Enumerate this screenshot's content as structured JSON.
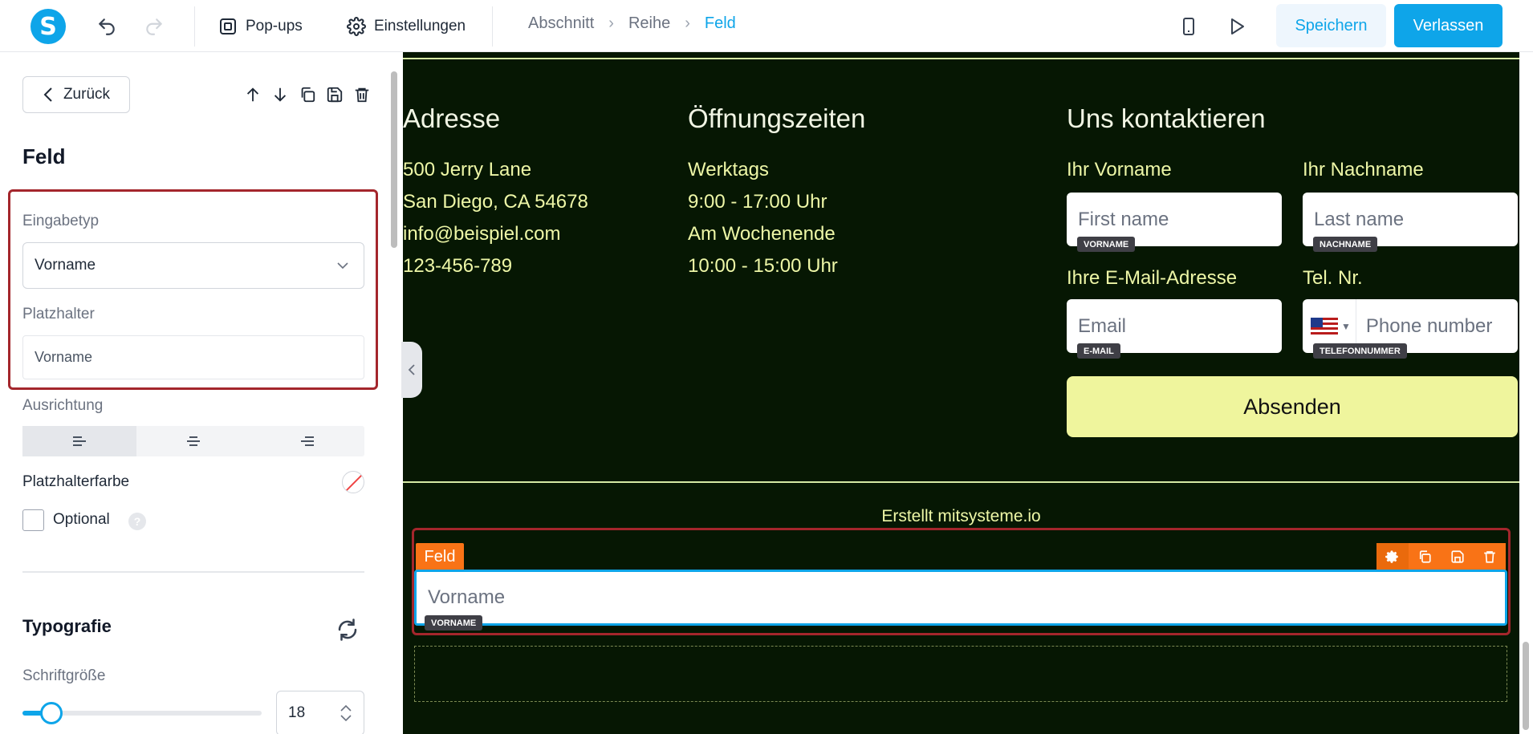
{
  "topbar": {
    "logo_letter": "S",
    "popups_label": "Pop-ups",
    "settings_label": "Einstellungen",
    "breadcrumb": [
      "Abschnitt",
      "Reihe",
      "Feld"
    ],
    "save_label": "Speichern",
    "exit_label": "Verlassen"
  },
  "sidebar": {
    "back_label": "Zurück",
    "title": "Feld",
    "input_type_label": "Eingabetyp",
    "input_type_value": "Vorname",
    "placeholder_label": "Platzhalter",
    "placeholder_value": "Vorname",
    "alignment_label": "Ausrichtung",
    "alignment_selected": "left",
    "placeholder_color_label": "Platzhalterfarbe",
    "optional_label": "Optional",
    "optional_checked": false,
    "help_icon": "?",
    "typography_title": "Typografie",
    "font_size_label": "Schriftgröße",
    "font_size_value": "18",
    "font_size_slider_fraction": 0.12
  },
  "canvas": {
    "address": {
      "heading": "Adresse",
      "lines": [
        "500 Jerry Lane",
        "San Diego, CA 54678",
        "info@beispiel.com",
        "123-456-789"
      ]
    },
    "hours": {
      "heading": "Öffnungszeiten",
      "lines": [
        "Werktags",
        "9:00 - 17:00 Uhr",
        "Am Wochenende",
        "10:00 - 15:00 Uhr"
      ]
    },
    "contact": {
      "heading": "Uns kontaktieren",
      "first_name_label": "Ihr Vorname",
      "first_name_placeholder": "First name",
      "first_name_tag": "VORNAME",
      "last_name_label": "Ihr Nachname",
      "last_name_placeholder": "Last name",
      "last_name_tag": "NACHNAME",
      "email_label": "Ihre E-Mail-Adresse",
      "email_placeholder": "Email",
      "email_tag": "E-MAIL",
      "phone_label": "Tel. Nr.",
      "phone_placeholder": "Phone number",
      "phone_tag": "TELEFONNUMMER",
      "submit_label": "Absenden"
    },
    "credit": "Erstellt mitsysteme.io",
    "selected_field": {
      "tag": "Feld",
      "placeholder": "Vorname",
      "input_tag": "VORNAME"
    }
  },
  "colors": {
    "accent": "#0ea5e9",
    "canvas_bg": "#061703",
    "text_yellow": "#eef7a7",
    "button_bg": "#eff59d",
    "field_toolbar": "#f97316",
    "selection_outline": "#a4262c"
  }
}
